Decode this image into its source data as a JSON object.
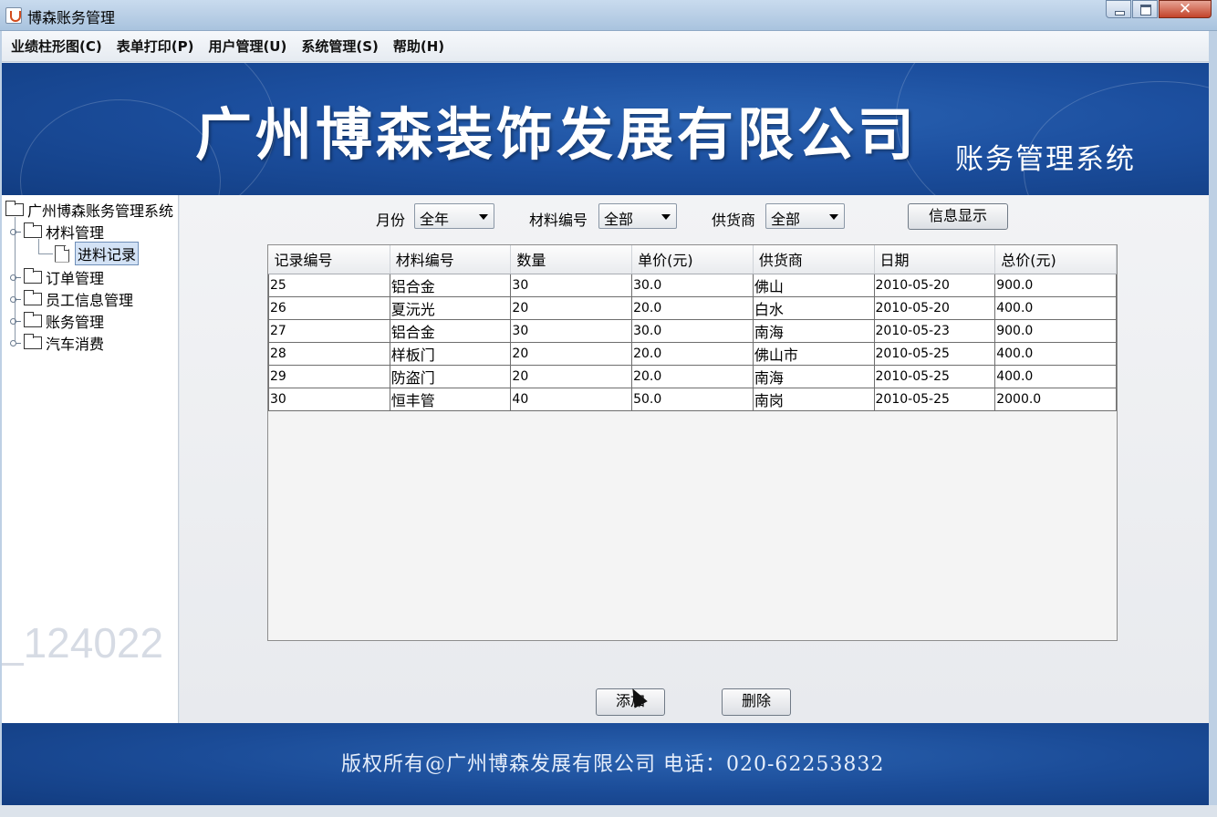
{
  "window": {
    "title": "博森账务管理"
  },
  "menu": [
    "业绩柱形图(C)",
    "表单打印(P)",
    "用户管理(U)",
    "系统管理(S)",
    "帮助(H)"
  ],
  "banner": {
    "company": "广州博森装饰发展有限公司",
    "system": "账务管理系统"
  },
  "tree": {
    "root": "广州博森账务管理系统",
    "material": "材料管理",
    "purchase_record": "进料记录",
    "order": "订单管理",
    "employee": "员工信息管理",
    "account": "账务管理",
    "car": "汽车消费"
  },
  "watermark": "_124022",
  "filters": {
    "month_label": "月份",
    "month_value": "全年",
    "material_label": "材料编号",
    "material_value": "全部",
    "supplier_label": "供货商",
    "supplier_value": "全部",
    "show_button": "信息显示"
  },
  "table": {
    "headers": [
      "记录编号",
      "材料编号",
      "数量",
      "单价(元)",
      "供货商",
      "日期",
      "总价(元)"
    ],
    "rows": [
      [
        "25",
        "铝合金",
        "30",
        "30.0",
        "佛山",
        "2010-05-20",
        "900.0"
      ],
      [
        "26",
        "夏沅光",
        "20",
        "20.0",
        "白水",
        "2010-05-20",
        "400.0"
      ],
      [
        "27",
        "铝合金",
        "30",
        "30.0",
        "南海",
        "2010-05-23",
        "900.0"
      ],
      [
        "28",
        "样板门",
        "20",
        "20.0",
        "佛山市",
        "2010-05-25",
        "400.0"
      ],
      [
        "29",
        "防盗门",
        "20",
        "20.0",
        "南海",
        "2010-05-25",
        "400.0"
      ],
      [
        "30",
        "恒丰管",
        "40",
        "50.0",
        "南岗",
        "2010-05-25",
        "2000.0"
      ]
    ]
  },
  "actions": {
    "add": "添加",
    "delete": "删除"
  },
  "footer": {
    "copyright": "版权所有@广州博森发展有限公司    电话：020-62253832"
  }
}
